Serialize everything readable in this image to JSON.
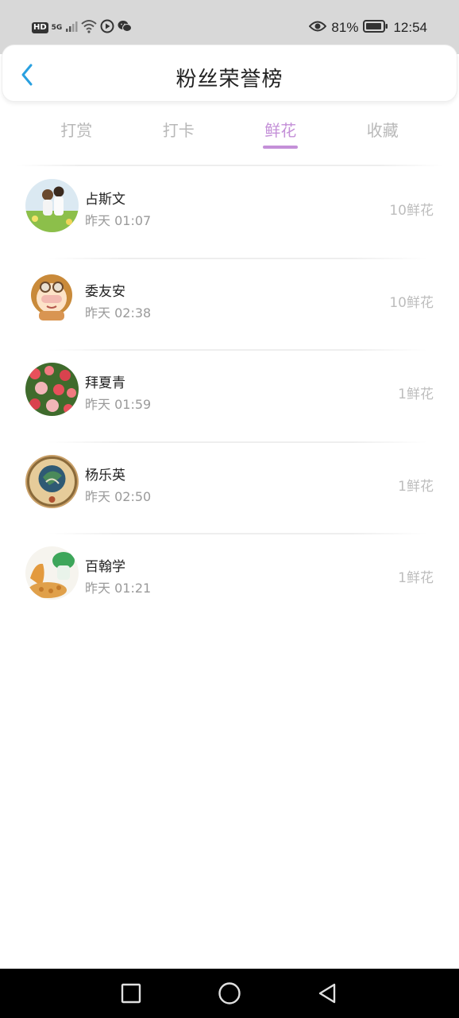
{
  "status_bar": {
    "hd": "HD",
    "network": "5G",
    "battery": "81%",
    "time": "12:54",
    "icons": [
      "signal-icon",
      "wifi-icon",
      "play-icon",
      "wechat-icon",
      "eye-icon",
      "battery-icon"
    ]
  },
  "header": {
    "title": "粉丝荣誉榜",
    "back_icon": "chevron-left-icon",
    "accent_color": "#29a0e0"
  },
  "tabs": [
    {
      "label": "打赏",
      "active": false
    },
    {
      "label": "打卡",
      "active": false
    },
    {
      "label": "鲜花",
      "active": true
    },
    {
      "label": "收藏",
      "active": false
    }
  ],
  "active_color": "#c490d8",
  "fans": [
    {
      "name": "占斯文",
      "time": "昨天 01:07",
      "amount": "10鲜花",
      "avatar": "couple-illustration-avatar"
    },
    {
      "name": "委友安",
      "time": "昨天 02:38",
      "amount": "10鲜花",
      "avatar": "cartoon-girl-avatar"
    },
    {
      "name": "拜夏青",
      "time": "昨天 01:59",
      "amount": "1鲜花",
      "avatar": "flowers-avatar"
    },
    {
      "name": "杨乐英",
      "time": "昨天 02:50",
      "amount": "1鲜花",
      "avatar": "emblem-avatar"
    },
    {
      "name": "百翰学",
      "time": "昨天 01:21",
      "amount": "1鲜花",
      "avatar": "food-avatar"
    }
  ],
  "nav_bar": {
    "buttons": [
      "recent-apps-icon",
      "home-icon",
      "back-triangle-icon"
    ]
  }
}
